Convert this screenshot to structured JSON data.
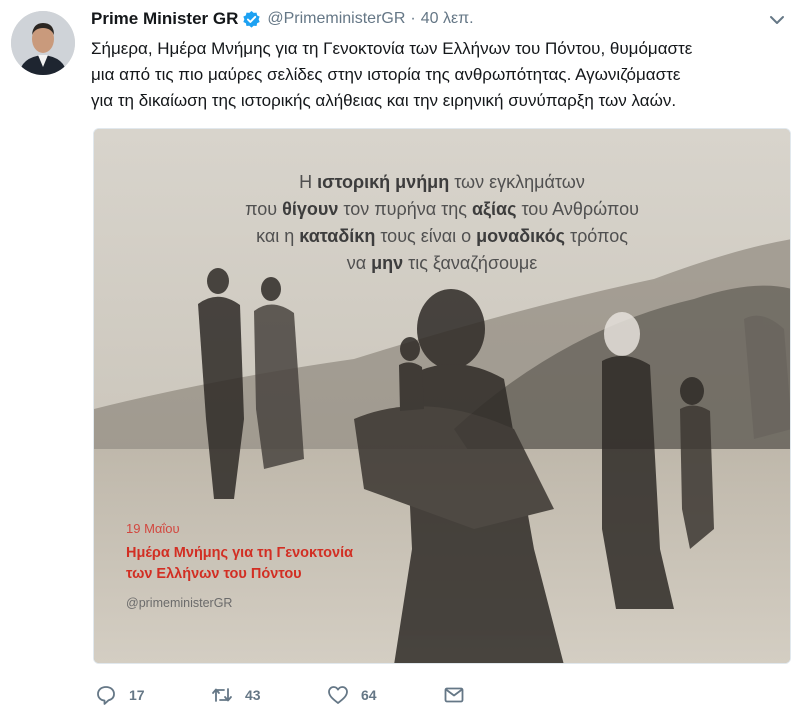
{
  "tweet": {
    "display_name": "Prime Minister GR",
    "handle": "@PrimeministerGR",
    "separator": "·",
    "time": "40 λεπ.",
    "verified_icon": "verified-badge-icon",
    "menu_icon": "chevron-down-icon",
    "text_lines": [
      "Σήμερα, Ημέρα Μνήμης για τη Γενοκτονία των Ελλήνων του Πόντου, θυμόμαστε",
      "μια από τις πιο μαύρες σελίδες στην ιστορία της ανθρωπότητας. Αγωνιζόμαστε",
      "για τη δικαίωση της ιστορικής αλήθειας και την ειρηνική συνύπαρξη των λαών."
    ]
  },
  "image": {
    "quote": {
      "line1": {
        "a": "Η ",
        "b": "ιστορική μνήμη",
        "c": " των εγκλημάτων"
      },
      "line2": {
        "a": "που ",
        "b": "θίγουν",
        "c": " τον πυρήνα της ",
        "d": "αξίας",
        "e": " του Ανθρώπου"
      },
      "line3": {
        "a": "και η ",
        "b": "καταδίκη",
        "c": " τους είναι ο ",
        "d": "μοναδικός",
        "e": " τρόπος"
      },
      "line4": {
        "a": "να ",
        "b": "μην",
        "c": " τις ξαναζήσουμε"
      }
    },
    "date": "19 Μαΐου",
    "remembrance_lines": [
      "Ημέρα Μνήμης για τη Γενοκτονία",
      "των Ελλήνων του Πόντου"
    ],
    "watermark": "@primeministerGR"
  },
  "actions": {
    "reply": {
      "icon": "reply-icon",
      "count": "17"
    },
    "retweet": {
      "icon": "retweet-icon",
      "count": "43"
    },
    "like": {
      "icon": "heart-icon",
      "count": "64"
    },
    "dm": {
      "icon": "envelope-icon"
    }
  },
  "colors": {
    "text": "#14171a",
    "secondary": "#657786",
    "verified": "#1da1f2",
    "accent_red": "#d22e23"
  }
}
